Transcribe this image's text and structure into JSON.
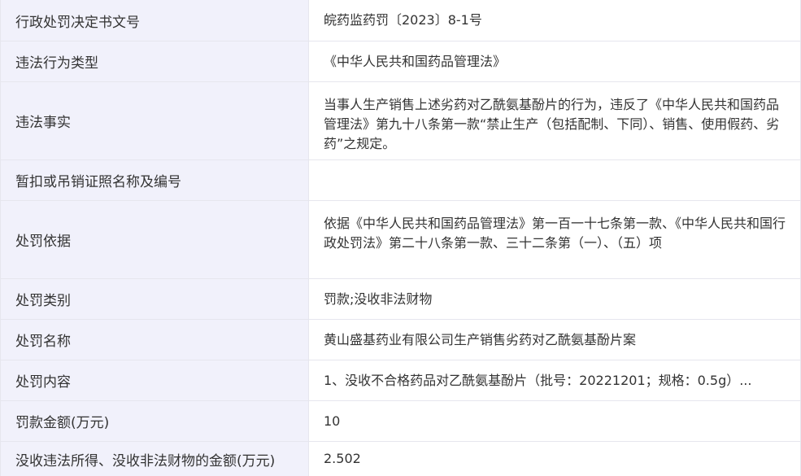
{
  "rows": [
    {
      "label": "行政处罚决定书文号",
      "value": "皖药监药罚〔2023〕8-1号"
    },
    {
      "label": "违法行为类型",
      "value": "《中华人民共和国药品管理法》"
    },
    {
      "label": "违法事实",
      "value": "当事人生产销售上述劣药对乙酰氨基酚片的行为，违反了《中华人民共和国药品管理法》第九十八条第一款“禁止生产（包括配制、下同）、销售、使用假药、劣药”之规定。"
    },
    {
      "label": "暂扣或吊销证照名称及编号",
      "value": ""
    },
    {
      "label": "处罚依据",
      "value": "依据《中华人民共和国药品管理法》第一百一十七条第一款、《中华人民共和国行政处罚法》第二十八条第一款、三十二条第（一）、（五）项"
    },
    {
      "label": "处罚类别",
      "value": "罚款;没收非法财物"
    },
    {
      "label": "处罚名称",
      "value": "黄山盛基药业有限公司生产销售劣药对乙酰氨基酚片案"
    },
    {
      "label": "处罚内容",
      "value": "1、没收不合格药品对乙酰氨基酚片（批号：20221201；规格：0.5g）..."
    },
    {
      "label": "罚款金额(万元)",
      "value": "10"
    },
    {
      "label": "没收违法所得、没收非法财物的金额(万元)",
      "value": "2.502"
    }
  ]
}
